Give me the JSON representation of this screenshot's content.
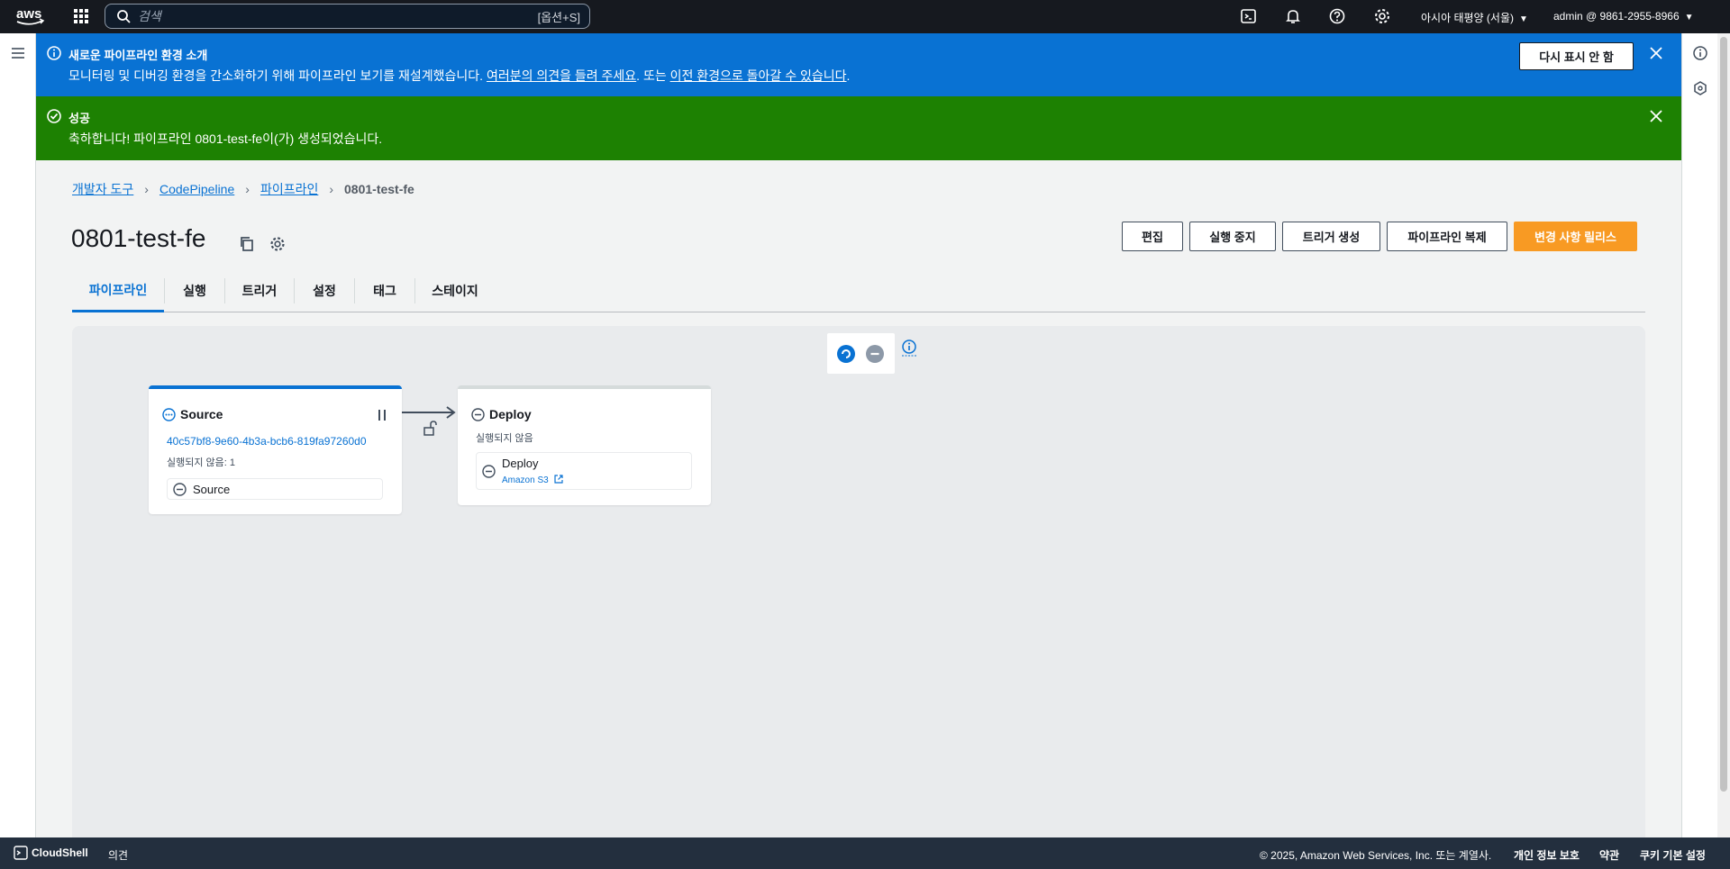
{
  "topnav": {
    "search_placeholder": "검색",
    "search_shortcut": "[옵션+S]",
    "region": "아시아 태평양 (서울)",
    "account": "admin @ 9861-2955-8966"
  },
  "info_banner": {
    "title": "새로운 파이프라인 환경 소개",
    "body_prefix": "모니터링 및 디버깅 환경을 간소화하기 위해 파이프라인 보기를 재설계했습니다. ",
    "link_feedback": "여러분의 의견을 들려 주세요",
    "body_middle": ". 또는 ",
    "link_revert": "이전 환경으로 돌아갈 수 있습니다",
    "body_suffix": ".",
    "dismiss_label": "다시 표시 안 함"
  },
  "success_banner": {
    "title": "성공",
    "body": "축하합니다! 파이프라인 0801-test-fe이(가) 생성되었습니다."
  },
  "breadcrumb": {
    "items": [
      "개발자 도구",
      "CodePipeline",
      "파이프라인"
    ],
    "current": "0801-test-fe"
  },
  "page": {
    "title": "0801-test-fe"
  },
  "actions": {
    "edit": "편집",
    "stop": "실행 중지",
    "create_trigger": "트리거 생성",
    "clone": "파이프라인 복제",
    "release": "변경 사항 릴리스"
  },
  "tabs": [
    "파이프라인",
    "실행",
    "트리거",
    "설정",
    "태그",
    "스테이지"
  ],
  "stages": {
    "source": {
      "name": "Source",
      "revision": "40c57bf8-9e60-4b3a-bcb6-819fa97260d0",
      "status": "실행되지 않음: 1",
      "action_name": "Source"
    },
    "deploy": {
      "name": "Deploy",
      "status": "실행되지 않음",
      "action_name": "Deploy",
      "action_provider": "Amazon S3"
    }
  },
  "footer": {
    "cloudshell": "CloudShell",
    "feedback": "의견",
    "copyright": "© 2025, Amazon Web Services, Inc. 또는 계열사.",
    "privacy": "개인 정보 보호",
    "terms": "약관",
    "cookies": "쿠키 기본 설정"
  },
  "colors": {
    "nav_bg": "#16191f",
    "info_blue": "#0972d3",
    "success_green": "#1d8102",
    "primary_orange": "#f89a23",
    "link_blue": "#0972d3"
  },
  "icons": [
    "aws-logo",
    "apps-grid-icon",
    "search-icon",
    "cloudshell-icon",
    "bell-icon",
    "help-icon",
    "gear-icon",
    "menu-icon",
    "info-icon",
    "close-icon",
    "success-check-icon",
    "copy-icon",
    "settings-gear-icon",
    "in-progress-icon",
    "stopped-icon",
    "pause-icon",
    "unlock-icon",
    "external-link-icon"
  ]
}
